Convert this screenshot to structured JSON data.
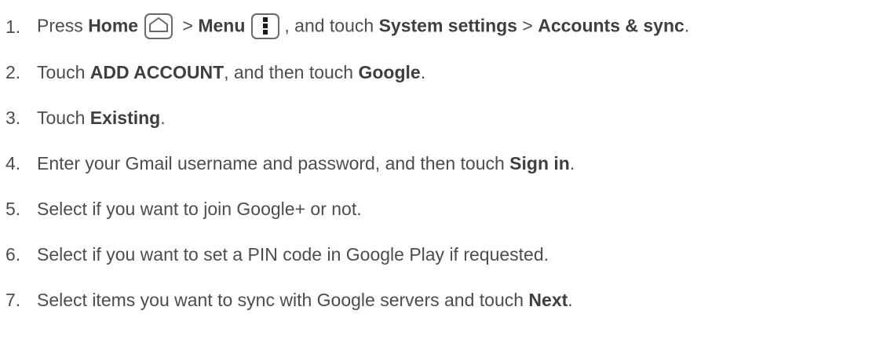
{
  "steps": [
    {
      "num": "1.",
      "parts": {
        "t1": "Press ",
        "b1": "Home",
        "t2": " > ",
        "b2": "Menu",
        "t3": ", and touch ",
        "b3": "System settings",
        "t4": " > ",
        "b4": "Accounts & sync",
        "t5": "."
      },
      "icons": [
        "home-key-icon",
        "menu-key-icon"
      ]
    },
    {
      "num": "2.",
      "parts": {
        "t1": "Touch ",
        "b1": "ADD ACCOUNT",
        "t2": ", and then touch ",
        "b2": "Google",
        "t3": "."
      }
    },
    {
      "num": "3.",
      "parts": {
        "t1": "Touch ",
        "b1": "Existing",
        "t2": "."
      }
    },
    {
      "num": "4.",
      "parts": {
        "t1": "Enter your Gmail username and password, and then touch ",
        "b1": "Sign in",
        "t2": "."
      }
    },
    {
      "num": "5.",
      "parts": {
        "t1": "Select if you want to join Google+ or not."
      }
    },
    {
      "num": "6.",
      "parts": {
        "t1": "Select if you want to set a PIN code in Google Play if requested."
      }
    },
    {
      "num": "7.",
      "parts": {
        "t1": "Select items you want to sync with Google servers and touch ",
        "b1": "Next",
        "t2": "."
      }
    }
  ],
  "colors": {
    "text": "#4d4d4d",
    "bold_text": "#3f3f3f",
    "icon_border": "#6a6a6a"
  }
}
